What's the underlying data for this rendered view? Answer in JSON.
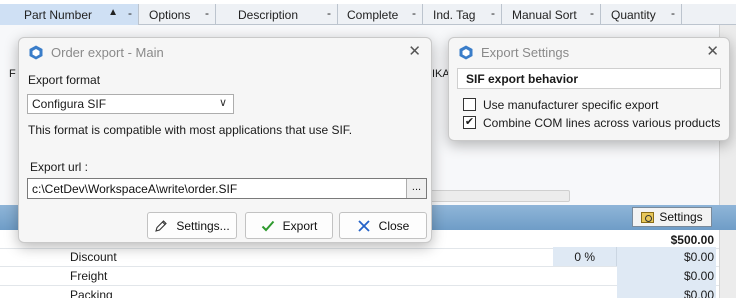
{
  "grid": {
    "columns": [
      {
        "label": "Part Number",
        "dash": "-",
        "sort": "▲"
      },
      {
        "label": "Options",
        "dash": "-"
      },
      {
        "label": "Description",
        "dash": "-"
      },
      {
        "label": "Complete",
        "dash": "-"
      },
      {
        "label": "Ind. Tag",
        "dash": "-"
      },
      {
        "label": "Manual Sort",
        "dash": "-"
      },
      {
        "label": "Quantity",
        "dash": "-"
      }
    ],
    "left_fragment": "F",
    "right_fragment": "IKA",
    "settings_label": "Settings",
    "total": "$500.00",
    "rows": [
      {
        "label": "Discount",
        "pct": "0 %",
        "amount": "$0.00"
      },
      {
        "label": "Freight",
        "pct": "",
        "amount": "$0.00"
      },
      {
        "label": "Packing",
        "pct": "",
        "amount": "$0.00"
      }
    ]
  },
  "order_export": {
    "title": "Order export - Main",
    "format_label": "Export format",
    "format_value": "Configura SIF",
    "format_description": "This format is compatible with most applications that use SIF.",
    "url_label": "Export url :",
    "url_value": "c:\\CetDev\\WorkspaceA\\write\\order.SIF",
    "browse_label": "...",
    "buttons": {
      "settings": "Settings...",
      "export": "Export",
      "close": "Close"
    }
  },
  "export_settings": {
    "title": "Export Settings",
    "section": "SIF export behavior",
    "options": [
      {
        "label": "Use manufacturer specific export",
        "checked": false
      },
      {
        "label": "Combine COM lines across various products",
        "checked": true
      }
    ]
  },
  "colors": {
    "accent": "#3a7dc9",
    "header_bar": "#7fa9d0",
    "export_check": "#2e9a2e",
    "close_x": "#2563c9"
  }
}
